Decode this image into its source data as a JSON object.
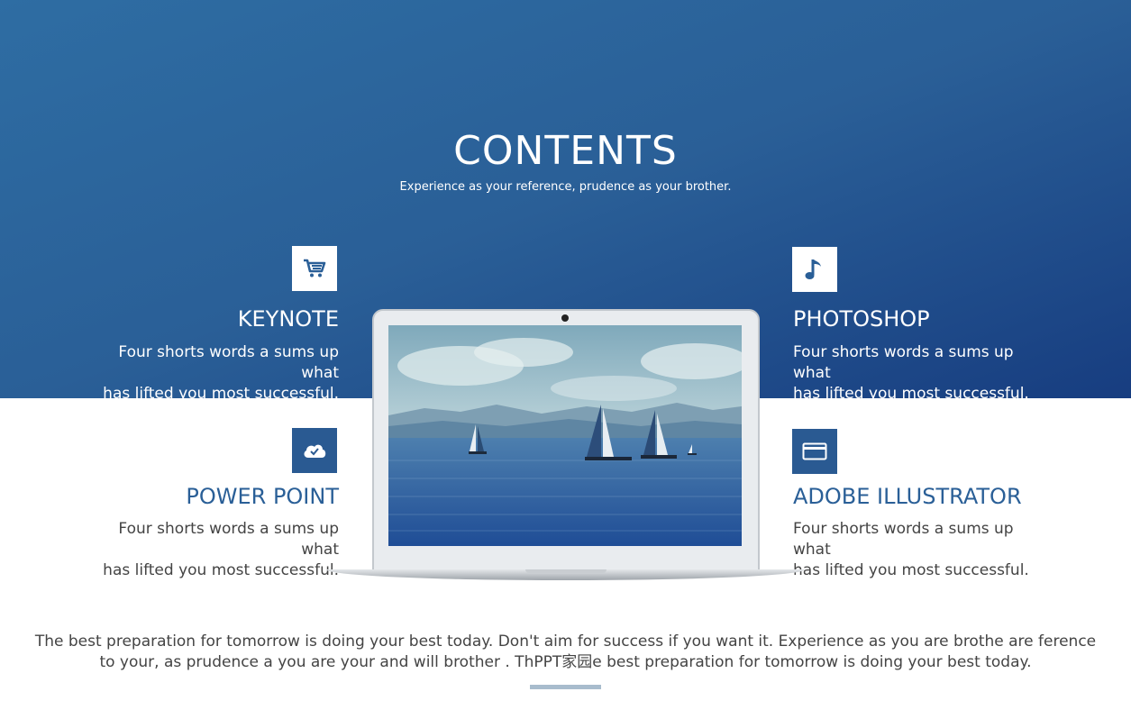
{
  "header": {
    "title": "CONTENTS",
    "subtitle": "Experience as your reference, prudence as your brother."
  },
  "items": [
    {
      "title": "KEYNOTE",
      "line1": "Four shorts words a sums up what",
      "line2": "has lifted you most successful.",
      "icon": "cart-icon"
    },
    {
      "title": "PHOTOSHOP",
      "line1": "Four shorts words a sums up what",
      "line2": "has lifted you most successful.",
      "icon": "music-note-icon"
    },
    {
      "title": "POWER POINT",
      "line1": "Four shorts words a sums up what",
      "line2": "has lifted you most successful.",
      "icon": "cloud-check-icon"
    },
    {
      "title": "ADOBE ILLUSTRATOR",
      "line1": "Four shorts words a sums up what",
      "line2": "has lifted you most successful.",
      "icon": "card-icon"
    }
  ],
  "footer": {
    "line1": "The best preparation for tomorrow is doing your best today. Don't aim for success if you want it. Experience as you are brothe are ference",
    "line2": "to your, as prudence a you are  your and will brother . ThPPT家园e best preparation for tomorrow is doing your best today."
  },
  "colors": {
    "primary_blue": "#2a5f97",
    "dark_blue": "#173d80",
    "text_gray": "#444444"
  }
}
